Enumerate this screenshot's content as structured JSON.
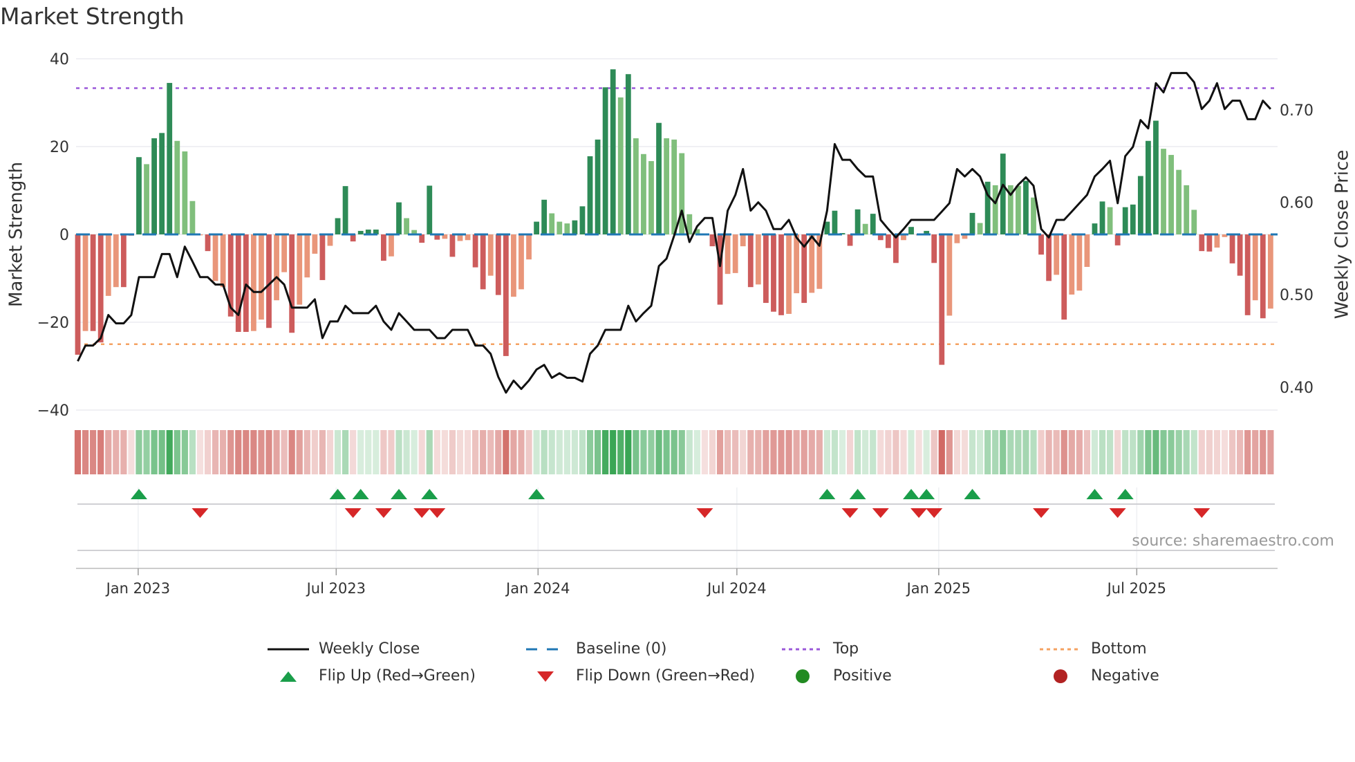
{
  "title": "Market Strength",
  "source": "source: sharemaestro.com",
  "colors": {
    "strong_green": "#2e8b57",
    "weak_green": "#80bf7c",
    "strong_red": "#cd5c5c",
    "weak_red": "#e9967a",
    "line": "#111111",
    "baseline": "#1f77b4",
    "top": "#9b59d9",
    "bottom": "#f4a261",
    "flip_up": "#1a9e4a",
    "flip_down": "#d62728",
    "positive": "#228b22",
    "negative": "#b22222"
  },
  "legend": [
    {
      "key": "weekly_close",
      "label": "Weekly Close"
    },
    {
      "key": "baseline",
      "label": "Baseline (0)"
    },
    {
      "key": "top",
      "label": "Top"
    },
    {
      "key": "bottom",
      "label": "Bottom"
    },
    {
      "key": "flip_up",
      "label": "Flip Up (Red→Green)"
    },
    {
      "key": "flip_down",
      "label": "Flip Down (Green→Red)"
    },
    {
      "key": "positive",
      "label": "Positive"
    },
    {
      "key": "negative",
      "label": "Negative"
    }
  ],
  "chart_data": {
    "type": "bar",
    "title": "Market Strength",
    "ylabel": "Market Strength",
    "y2label": "Weekly Close Price",
    "ylim": [
      -43,
      44
    ],
    "y2lim": [
      0.374,
      0.755
    ],
    "yticks": [
      {
        "v": 40,
        "label": "40"
      },
      {
        "v": 20,
        "label": "20"
      },
      {
        "v": 0,
        "label": "0"
      },
      {
        "v": -20,
        "label": "−20"
      },
      {
        "v": -40,
        "label": "−40"
      }
    ],
    "y2ticks": [
      {
        "v": 0.7,
        "label": "0.70"
      },
      {
        "v": 0.6,
        "label": "0.60"
      },
      {
        "v": 0.5,
        "label": "0.50"
      },
      {
        "v": 0.4,
        "label": "0.40"
      }
    ],
    "xticks": [
      {
        "week": 7.9,
        "label": "Jan 2023"
      },
      {
        "week": 33.8,
        "label": "Jul 2023"
      },
      {
        "week": 60.2,
        "label": "Jan 2024"
      },
      {
        "week": 86.2,
        "label": "Jul 2024"
      },
      {
        "week": 112.6,
        "label": "Jan 2025"
      },
      {
        "week": 138.5,
        "label": "Jul 2025"
      }
    ],
    "top_level": 33.3,
    "bottom_level": -25,
    "baseline": 0,
    "strength": [
      -27.4,
      -22,
      -22,
      -24.6,
      -14,
      -12,
      -12,
      -0.3,
      17.6,
      16,
      21.9,
      23.1,
      34.5,
      21.3,
      18.9,
      7.6,
      -0.2,
      -3.8,
      -10.6,
      -12,
      -18.7,
      -22.2,
      -22.2,
      -22,
      -19.4,
      -21.3,
      -15,
      -8.6,
      -22.4,
      -16,
      -9.8,
      -4.4,
      -10.4,
      -2.6,
      3.7,
      11,
      -1.6,
      0.8,
      1.1,
      1.1,
      -6,
      -5,
      7.3,
      3.7,
      1,
      -1.9,
      11.1,
      -1.2,
      -1,
      -5.1,
      -1.5,
      -1.3,
      -7.5,
      -12.5,
      -9.4,
      -13.8,
      -27.7,
      -14.2,
      -12.5,
      -5.7,
      2.9,
      7.9,
      4.8,
      2.9,
      2.5,
      3.2,
      6.4,
      17.8,
      21.6,
      33.5,
      37.6,
      31.2,
      36.5,
      21.9,
      18.3,
      16.7,
      25.4,
      21.9,
      21.6,
      18.5,
      4.6,
      1.2,
      -0.2,
      -2.7,
      -16,
      -9,
      -8.8,
      -2.7,
      -12,
      -11.4,
      -15.6,
      -17.6,
      -18.4,
      -18.1,
      -13.4,
      -15.6,
      -13.3,
      -12.4,
      2.9,
      5.4,
      0.3,
      -2.6,
      5.7,
      2.4,
      4.7,
      -1.3,
      -3.1,
      -6.5,
      -1.3,
      1.7,
      -0.2,
      0.8,
      -6.5,
      -29.7,
      -18.5,
      -2,
      -1,
      4.9,
      2.6,
      12,
      11.2,
      18.4,
      11.2,
      11.1,
      12.2,
      8.4,
      -4.6,
      -10.6,
      -9.2,
      -19.4,
      -13.7,
      -12.8,
      -7.4,
      2.5,
      7.5,
      6.2,
      -2.5,
      6.2,
      6.8,
      13.3,
      21.3,
      25.9,
      19.5,
      18.1,
      14.7,
      11.2,
      5.6,
      -3.8,
      -3.9,
      -3,
      -0.6,
      -6.6,
      -9.4,
      -18.4,
      -15,
      -19.1,
      -16.9
    ],
    "shade": [
      "D",
      "L",
      "D",
      "D",
      "L",
      "L",
      "D",
      "L",
      "D",
      "L",
      "D",
      "D",
      "D",
      "L",
      "L",
      "L",
      "L",
      "D",
      "L",
      "L",
      "D",
      "D",
      "D",
      "L",
      "L",
      "D",
      "L",
      "L",
      "D",
      "L",
      "L",
      "L",
      "D",
      "L",
      "D",
      "D",
      "D",
      "D",
      "D",
      "D",
      "D",
      "L",
      "D",
      "L",
      "L",
      "D",
      "D",
      "D",
      "L",
      "D",
      "L",
      "L",
      "D",
      "D",
      "L",
      "D",
      "D",
      "L",
      "L",
      "L",
      "D",
      "D",
      "L",
      "L",
      "L",
      "D",
      "D",
      "D",
      "D",
      "D",
      "D",
      "L",
      "D",
      "L",
      "L",
      "L",
      "D",
      "L",
      "L",
      "L",
      "L",
      "L",
      "L",
      "D",
      "D",
      "L",
      "L",
      "L",
      "D",
      "L",
      "D",
      "D",
      "D",
      "L",
      "L",
      "D",
      "L",
      "L",
      "D",
      "D",
      "D",
      "D",
      "D",
      "L",
      "D",
      "D",
      "D",
      "D",
      "L",
      "D",
      "D",
      "D",
      "D",
      "D",
      "L",
      "L",
      "L",
      "D",
      "L",
      "D",
      "L",
      "D",
      "L",
      "L",
      "D",
      "L",
      "D",
      "D",
      "L",
      "D",
      "L",
      "L",
      "L",
      "D",
      "D",
      "L",
      "D",
      "D",
      "D",
      "D",
      "D",
      "D",
      "L",
      "L",
      "L",
      "L",
      "L",
      "D",
      "D",
      "L",
      "L",
      "D",
      "D",
      "D",
      "L",
      "D",
      "L"
    ],
    "weekly_close": [
      0.428,
      0.445,
      0.445,
      0.453,
      0.478,
      0.469,
      0.469,
      0.478,
      0.519,
      0.519,
      0.519,
      0.544,
      0.544,
      0.519,
      0.552,
      0.536,
      0.519,
      0.519,
      0.511,
      0.511,
      0.486,
      0.478,
      0.511,
      0.503,
      0.503,
      0.511,
      0.519,
      0.511,
      0.486,
      0.486,
      0.486,
      0.495,
      0.453,
      0.471,
      0.471,
      0.488,
      0.48,
      0.48,
      0.48,
      0.488,
      0.471,
      0.462,
      0.48,
      0.471,
      0.462,
      0.462,
      0.462,
      0.453,
      0.453,
      0.462,
      0.462,
      0.462,
      0.445,
      0.445,
      0.436,
      0.411,
      0.394,
      0.407,
      0.398,
      0.407,
      0.419,
      0.424,
      0.41,
      0.415,
      0.41,
      0.41,
      0.406,
      0.436,
      0.445,
      0.462,
      0.462,
      0.462,
      0.488,
      0.471,
      0.48,
      0.488,
      0.531,
      0.539,
      0.564,
      0.591,
      0.557,
      0.574,
      0.583,
      0.583,
      0.531,
      0.591,
      0.608,
      0.636,
      0.591,
      0.6,
      0.591,
      0.571,
      0.571,
      0.581,
      0.562,
      0.552,
      0.563,
      0.553,
      0.591,
      0.663,
      0.646,
      0.646,
      0.636,
      0.628,
      0.628,
      0.581,
      0.571,
      0.562,
      0.571,
      0.581,
      0.581,
      0.581,
      0.581,
      0.59,
      0.599,
      0.636,
      0.628,
      0.636,
      0.628,
      0.608,
      0.599,
      0.619,
      0.608,
      0.619,
      0.627,
      0.618,
      0.571,
      0.562,
      0.581,
      0.581,
      0.59,
      0.599,
      0.608,
      0.628,
      0.636,
      0.645,
      0.599,
      0.65,
      0.66,
      0.689,
      0.68,
      0.729,
      0.719,
      0.74,
      0.74,
      0.74,
      0.73,
      0.701,
      0.71,
      0.729,
      0.701,
      0.71,
      0.71,
      0.69,
      0.69,
      0.71,
      0.701
    ],
    "flip_up_weeks": [
      8,
      34,
      37,
      42,
      46,
      60,
      98,
      102,
      109,
      111,
      117,
      133,
      137
    ],
    "flip_down_weeks": [
      16,
      36,
      40,
      45,
      47,
      82,
      101,
      105,
      110,
      112,
      126,
      136,
      147
    ]
  }
}
